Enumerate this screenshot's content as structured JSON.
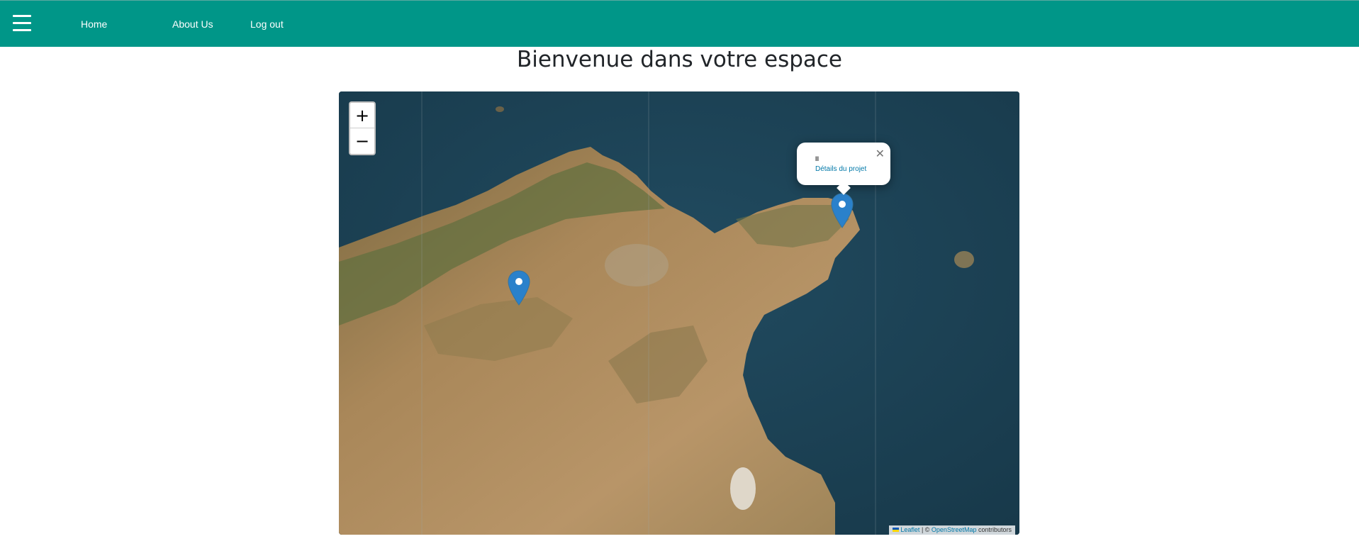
{
  "nav": {
    "menu_icon": "hamburger-icon",
    "links": [
      "Home",
      "About Us",
      "Log out"
    ],
    "background": "#009688"
  },
  "page": {
    "title": "Bienvenue dans votre espace"
  },
  "map": {
    "zoom_in": "+",
    "zoom_out": "−",
    "popup": {
      "name": "ll",
      "link": "Détails du projet",
      "close": "✕"
    },
    "markers": [
      {
        "name": "marker-inland",
        "icon": "map-pin-icon"
      },
      {
        "name": "marker-coast",
        "icon": "map-pin-icon"
      }
    ],
    "attribution": {
      "leaflet": "Leaflet",
      "separator": " | © ",
      "osm": "OpenStreetMap",
      "suffix": " contributors"
    }
  }
}
